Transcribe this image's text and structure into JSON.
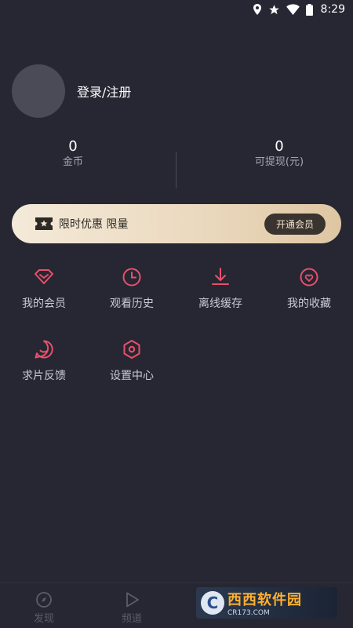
{
  "status_bar": {
    "time": "8:29",
    "icons": [
      "location-icon",
      "star-icon",
      "wifi-icon",
      "battery-icon"
    ]
  },
  "profile": {
    "login_label": "登录/注册"
  },
  "stats": {
    "coins": {
      "value": "0",
      "label": "金币"
    },
    "withdrawable": {
      "value": "0",
      "label": "可提现(元)"
    }
  },
  "vip_banner": {
    "text": "限时优惠 限量",
    "button_label": "开通会员"
  },
  "menu": [
    {
      "label": "我的会员",
      "icon": "diamond-icon"
    },
    {
      "label": "观看历史",
      "icon": "clock-icon"
    },
    {
      "label": "离线缓存",
      "icon": "download-icon"
    },
    {
      "label": "我的收藏",
      "icon": "heart-icon"
    },
    {
      "label": "求片反馈",
      "icon": "feedback-icon"
    },
    {
      "label": "设置中心",
      "icon": "settings-icon"
    }
  ],
  "bottom_nav": [
    {
      "label": "发现",
      "icon": "compass-icon"
    },
    {
      "label": "频道",
      "icon": "play-icon"
    }
  ],
  "watermark": {
    "title": "西西软件园",
    "subtitle": "CR173.COM"
  },
  "colors": {
    "background": "#262733",
    "accent": "#e8506a",
    "banner_gold": "#ead8bd"
  }
}
